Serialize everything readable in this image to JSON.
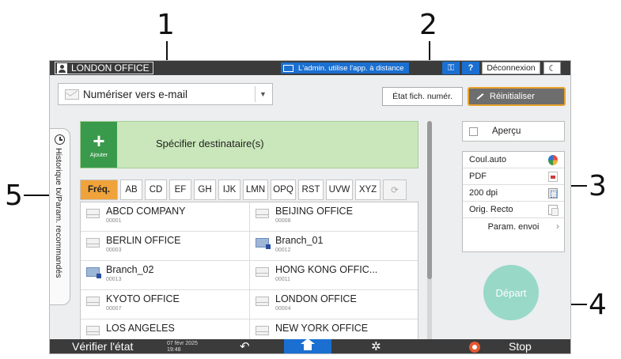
{
  "callouts": [
    "1",
    "2",
    "3",
    "4",
    "5"
  ],
  "topbar": {
    "user_label": "LONDON OFFICE",
    "remote_label": "L'admin. utilise l'app. à distance",
    "help_label": "?",
    "logout_label": "Déconnexion",
    "moon_glyph": "☾",
    "key_glyph": "⚿"
  },
  "function_select": {
    "value": "Numériser vers e-mail",
    "arrow": "▼"
  },
  "status_button": {
    "label": "État fich. numér."
  },
  "reset_button": {
    "label": "Réinitialiser"
  },
  "history_tab": {
    "label": "Historique tx/Param. recommandés"
  },
  "add_destination": {
    "plus": "+",
    "button_text": "Ajouter",
    "label": "Spécifier destinataire(s)"
  },
  "alpha_tabs": [
    {
      "label": "Fréq.",
      "active": true
    },
    {
      "label": "AB"
    },
    {
      "label": "CD"
    },
    {
      "label": "EF"
    },
    {
      "label": "GH"
    },
    {
      "label": "IJK"
    },
    {
      "label": "LMN"
    },
    {
      "label": "OPQ"
    },
    {
      "label": "RST"
    },
    {
      "label": "UVW"
    },
    {
      "label": "XYZ"
    },
    {
      "label": "⟳",
      "refresh": true
    }
  ],
  "destinations": [
    {
      "name": "ABCD COMPANY",
      "number": "00001",
      "icon": "mail-icon"
    },
    {
      "name": "BEIJING OFFICE",
      "number": "00008",
      "icon": "mail-icon"
    },
    {
      "name": "BERLIN OFFICE",
      "number": "00003",
      "icon": "mail-icon"
    },
    {
      "name": "Branch_01",
      "number": "00012",
      "icon": "folder-icon"
    },
    {
      "name": "Branch_02",
      "number": "00013",
      "icon": "folder-icon"
    },
    {
      "name": "HONG KONG OFFIC...",
      "number": "00011",
      "icon": "mail-icon"
    },
    {
      "name": "KYOTO OFFICE",
      "number": "00007",
      "icon": "mail-icon"
    },
    {
      "name": "LONDON OFFICE",
      "number": "00004",
      "icon": "mail-icon"
    },
    {
      "name": "LOS ANGELES",
      "number": "",
      "icon": "mail-icon"
    },
    {
      "name": "NEW YORK OFFICE",
      "number": "",
      "icon": "mail-icon"
    }
  ],
  "settings": {
    "preview_label": "Aperçu",
    "rows": [
      {
        "label": "Coul.auto",
        "icon": "color-icon"
      },
      {
        "label": "PDF",
        "icon": "pdf-icon"
      },
      {
        "label": "200 dpi",
        "icon": "resolution-icon"
      },
      {
        "label": "Orig. Recto",
        "icon": "original-icon"
      },
      {
        "label": "Param. envoi",
        "icon": "chevron-right-icon"
      }
    ],
    "chevron": "›"
  },
  "start_button": {
    "label": "Départ"
  },
  "bottombar": {
    "check_status": "Vérifier l'état",
    "date": "07 févr 2025",
    "time": "19:48",
    "back_glyph": "↶",
    "gear_glyph": "✲",
    "stop_label": "Stop"
  }
}
